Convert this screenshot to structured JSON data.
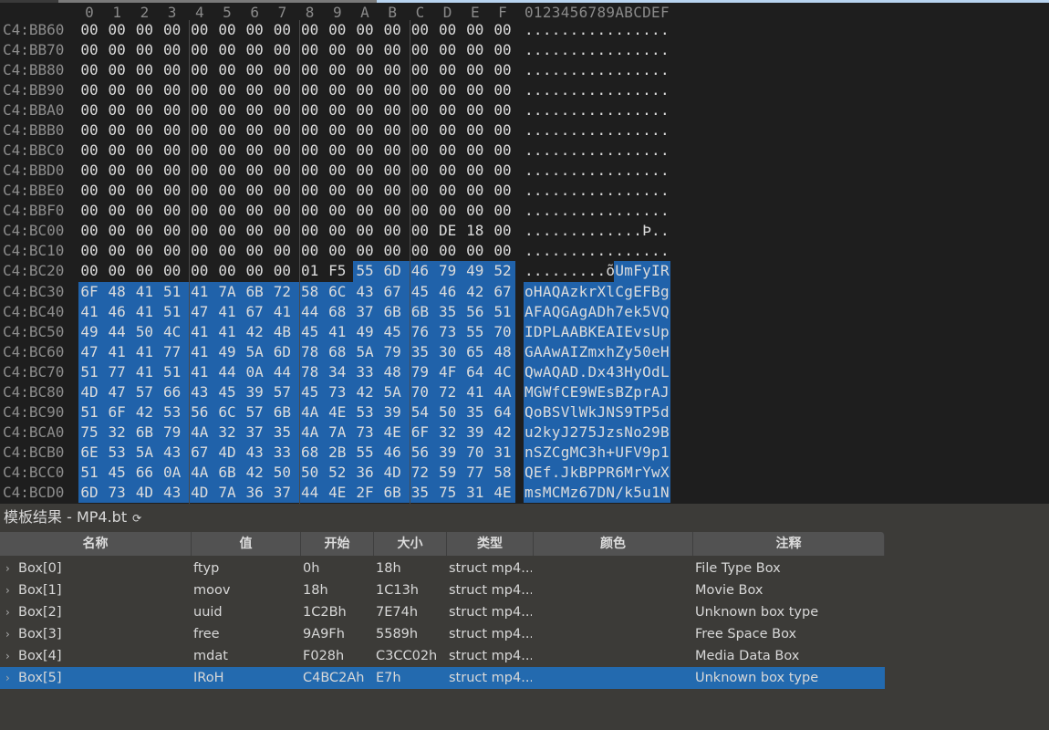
{
  "hex_editor": {
    "column_header": [
      "0",
      "1",
      "2",
      "3",
      "4",
      "5",
      "6",
      "7",
      "8",
      "9",
      "A",
      "B",
      "C",
      "D",
      "E",
      "F"
    ],
    "ascii_header": "0123456789ABCDEF",
    "selection_start": {
      "row": 12,
      "col": 10
    },
    "selection_color": "#2062aa",
    "rows": [
      {
        "address": "C4:BB60",
        "hex": "00000000000000000000000000000000",
        "ascii": "................"
      },
      {
        "address": "C4:BB70",
        "hex": "00000000000000000000000000000000",
        "ascii": "................"
      },
      {
        "address": "C4:BB80",
        "hex": "00000000000000000000000000000000",
        "ascii": "................"
      },
      {
        "address": "C4:BB90",
        "hex": "00000000000000000000000000000000",
        "ascii": "................"
      },
      {
        "address": "C4:BBA0",
        "hex": "00000000000000000000000000000000",
        "ascii": "................"
      },
      {
        "address": "C4:BBB0",
        "hex": "00000000000000000000000000000000",
        "ascii": "................"
      },
      {
        "address": "C4:BBC0",
        "hex": "00000000000000000000000000000000",
        "ascii": "................"
      },
      {
        "address": "C4:BBD0",
        "hex": "00000000000000000000000000000000",
        "ascii": "................"
      },
      {
        "address": "C4:BBE0",
        "hex": "00000000000000000000000000000000",
        "ascii": "................"
      },
      {
        "address": "C4:BBF0",
        "hex": "00000000000000000000000000000000",
        "ascii": "................"
      },
      {
        "address": "C4:BC00",
        "hex": "00000000000000000000000000DE1800",
        "ascii": ".............Þ.."
      },
      {
        "address": "C4:BC10",
        "hex": "00000000000000000000000000000000",
        "ascii": "................"
      },
      {
        "address": "C4:BC20",
        "hex": "000000000000000001F5556D46794952",
        "ascii": ".........õUmFyIR"
      },
      {
        "address": "C4:BC30",
        "hex": "6F484151417A6B72586C436745464267",
        "ascii": "oHAQAzkrXlCgEFBg"
      },
      {
        "address": "C4:BC40",
        "hex": "41464151474167414468376B6B355651",
        "ascii": "AFAQGAgADh7ek5VQ"
      },
      {
        "address": "C4:BC50",
        "hex": "4944504C4141424B4541494576735570",
        "ascii": "IDPLAABKEAIEvsUp"
      },
      {
        "address": "C4:BC60",
        "hex": "474141774149 5A6D78685A7935306548",
        "ascii": "GAAwAIZmxhZy50eH"
      },
      {
        "address": "C4:BC70",
        "hex": "5177415141440A447834334879 4F644C",
        "ascii": "QwAQAD.Dx43HyOdL"
      },
      {
        "address": "C4:BC80",
        "hex": "4D475766434539574573425A7072414A",
        "ascii": "MGWfCE9WEsBZprAJ"
      },
      {
        "address": "C4:BC90",
        "hex": "516F425356 6C576B4A4E5339545035 64",
        "ascii": "QoBSVlWkJNS9TP5d"
      },
      {
        "address": "C4:BCA0",
        "hex": "75326B794A3237354A7A734E6F323942",
        "ascii": "u2kyJ275JzsNo29B"
      },
      {
        "address": "C4:BCB0",
        "hex": "6E535A43674D4333682B554656397031",
        "ascii": "nSZCgMC3h+UFV9p1"
      },
      {
        "address": "C4:BCC0",
        "hex": "5145660A4A6B425050523 64D72597758",
        "ascii": "QEf.JkBPPR6MrYwX"
      },
      {
        "address": "C4:BCD0",
        "hex": "6D734D434D7A3637444E2F6B3575314E",
        "ascii": "msMCMz67DN/k5u1N"
      }
    ]
  },
  "template_results": {
    "title": "模板结果 - MP4.bt",
    "refresh_icon": "refresh-icon",
    "columns": [
      "名称",
      "值",
      "开始",
      "大小",
      "类型",
      "颜色",
      "注释"
    ],
    "selected_row": 5,
    "selected_color": "#236aaf",
    "rows": [
      {
        "name": "Box[0]",
        "value": "ftyp",
        "start": "0h",
        "size": "18h",
        "type": "struct mp4...",
        "color": "",
        "comment": "File Type Box"
      },
      {
        "name": "Box[1]",
        "value": "moov",
        "start": "18h",
        "size": "1C13h",
        "type": "struct mp4...",
        "color": "",
        "comment": "Movie Box"
      },
      {
        "name": "Box[2]",
        "value": "uuid",
        "start": "1C2Bh",
        "size": "7E74h",
        "type": "struct mp4...",
        "color": "",
        "comment": "Unknown box type"
      },
      {
        "name": "Box[3]",
        "value": "free",
        "start": "9A9Fh",
        "size": "5589h",
        "type": "struct mp4...",
        "color": "",
        "comment": "Free Space Box"
      },
      {
        "name": "Box[4]",
        "value": "mdat",
        "start": "F028h",
        "size": "C3CC02h",
        "type": "struct mp4...",
        "color": "",
        "comment": "Media Data Box"
      },
      {
        "name": "Box[5]",
        "value": "IRoH",
        "start": "C4BC2Ah",
        "size": "E7h",
        "type": "struct mp4...",
        "color": "",
        "comment": "Unknown box type"
      }
    ]
  }
}
